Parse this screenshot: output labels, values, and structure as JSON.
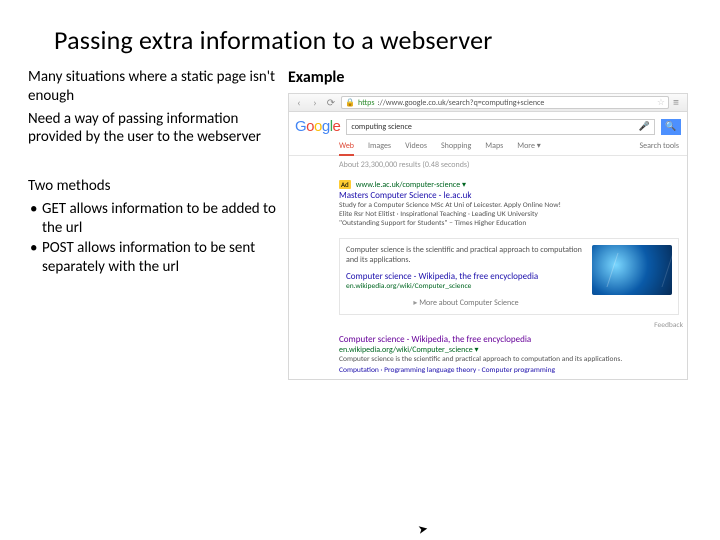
{
  "title": "Passing extra information to a webserver",
  "left": {
    "p1": "Many situations where a static page isn't enough",
    "p2": "Need a way of passing information provided by the user to the webserver",
    "p3": "Two methods",
    "li1": "GET allows information to be added to the url",
    "li2": "POST allows information to be sent separately with the url"
  },
  "right": {
    "heading": "Example",
    "url_https": "https",
    "url_rest": "://www.google.co.uk/search?q=computing+science",
    "logo": {
      "g": "G",
      "o1": "o",
      "o2": "o",
      "g2": "g",
      "l": "l",
      "e": "e"
    },
    "query": "computing science",
    "tabs": {
      "web": "Web",
      "images": "Images",
      "videos": "Videos",
      "shopping": "Shopping",
      "maps": "Maps",
      "more": "More ▾",
      "tools": "Search tools"
    },
    "stats": "About 23,300,000 results (0.48 seconds)",
    "ad": {
      "badge": "Ad",
      "title": "Masters Computer Science - le.ac.uk",
      "cite": "www.le.ac.uk/computer-science ▾",
      "l1": "Study for a Computer Science MSc At Uni of Leicester. Apply Online Now!",
      "l2": "Elite Rsr Not Elitist · Inspirational Teaching · Leading UK University",
      "l3": "\"Outstanding Support for Students\" – Times Higher Education"
    },
    "kp": {
      "snippet": "Computer science is the scientific and practical approach to computation and its applications.",
      "link": "Computer science - Wikipedia, the free encyclopedia",
      "cite": "en.wikipedia.org/wiki/Computer_science",
      "more": "More about Computer Science",
      "feedback": "Feedback"
    },
    "r2": {
      "title": "Computer science - Wikipedia, the free encyclopedia",
      "cite": "en.wikipedia.org/wiki/Computer_science ▾",
      "desc": "Computer science is the scientific and practical approach to computation and its applications.",
      "links_label": "Computation",
      "links_rest": " · Programming language theory · Computer programming"
    }
  }
}
